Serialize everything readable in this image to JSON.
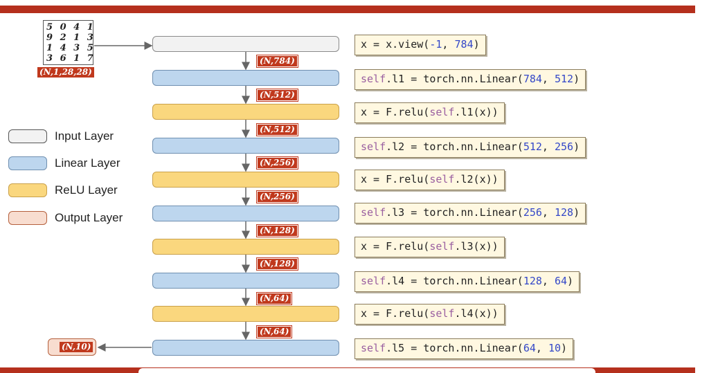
{
  "input_image": {
    "digit_rows": [
      "5 0 4 1",
      "9 2 1 3",
      "1 4 3 5",
      "3 6 1 7"
    ],
    "shape": "(N,1,28,28)"
  },
  "legend": [
    {
      "label": "Input Layer",
      "color": "#f2f2f2"
    },
    {
      "label": "Linear Layer",
      "color": "#bdd6ee"
    },
    {
      "label": "ReLU Layer",
      "color": "#fad77e"
    },
    {
      "label": "Output Layer",
      "color": "#f8ddd0"
    }
  ],
  "shape_labels": [
    "(N,784)",
    "(N,512)",
    "(N,512)",
    "(N,256)",
    "(N,256)",
    "(N,128)",
    "(N,128)",
    "(N,64)",
    "(N,64)"
  ],
  "output_shape": "(N,10)",
  "code_lines": [
    "x = x.view(-1, 784)",
    "self.l1 = torch.nn.Linear(784, 512)",
    "x = F.relu(self.l1(x))",
    "self.l2 = torch.nn.Linear(512, 256)",
    "x = F.relu(self.l2(x))",
    "self.l3 = torch.nn.Linear(256, 128)",
    "x = F.relu(self.l3(x))",
    "self.l4 = torch.nn.Linear(128, 64)",
    "x = F.relu(self.l4(x))",
    "self.l5 = torch.nn.Linear(64, 10)"
  ],
  "colors": {
    "accent_red": "#b5301d",
    "linear": "#bdd6ee",
    "relu": "#fad77e",
    "input": "#f2f2f2",
    "output": "#f8ddd0",
    "code_bg": "#fff8e1"
  }
}
